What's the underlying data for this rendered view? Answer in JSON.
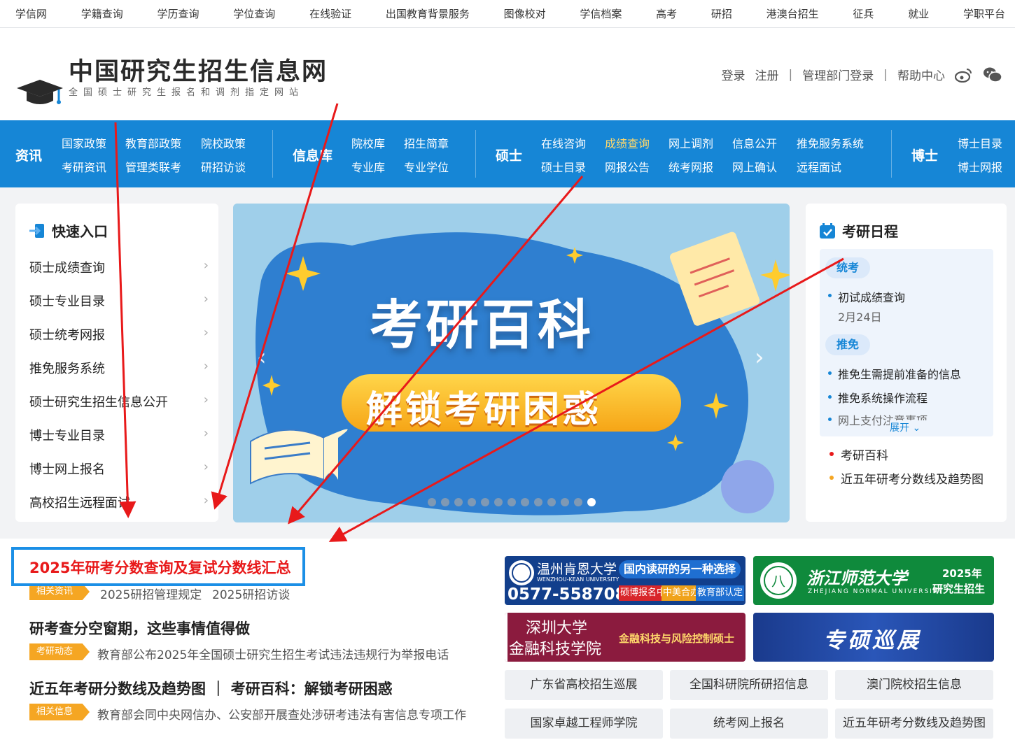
{
  "topbar": [
    "学信网",
    "学籍查询",
    "学历查询",
    "学位查询",
    "在线验证",
    "出国教育背景服务",
    "图像校对",
    "学信档案",
    "高考",
    "研招",
    "港澳台招生",
    "征兵",
    "就业",
    "学职平台"
  ],
  "header": {
    "title": "中国研究生招生信息网",
    "subtitle": "全国硕士研究生报名和调剂指定网站",
    "login": "登录",
    "register": "注册",
    "admin_login": "管理部门登录",
    "help": "帮助中心",
    "sep": "|"
  },
  "nav": {
    "zixun": {
      "head": "资讯",
      "links": [
        "国家政策",
        "教育部政策",
        "院校政策",
        "考研资讯",
        "管理类联考",
        "研招访谈"
      ]
    },
    "xinxiku": {
      "head": "信息库",
      "links": [
        "院校库",
        "招生简章",
        "专业库",
        "专业学位"
      ]
    },
    "shuoshi": {
      "head": "硕士",
      "links": [
        "在线咨询",
        "成绩查询",
        "网上调剂",
        "信息公开",
        "推免服务系统",
        "硕士目录",
        "网报公告",
        "统考网报",
        "网上确认",
        "远程面试"
      ]
    },
    "boshi": {
      "head": "博士",
      "links": [
        "博士目录",
        "博士网报"
      ]
    }
  },
  "quick": {
    "title": "快速入口",
    "items": [
      "硕士成绩查询",
      "硕士专业目录",
      "硕士统考网报",
      "推免服务系统",
      "硕士研究生招生信息公开",
      "博士专业目录",
      "博士网上报名",
      "高校招生远程面试"
    ]
  },
  "banner": {
    "title": "考研百科",
    "subtitle": "解锁考研困惑",
    "prev": "‹",
    "next": "›",
    "slide_count": 13,
    "active_slide": 13
  },
  "schedule": {
    "title": "考研日程",
    "tag1": "统考",
    "item1": "初试成绩查询",
    "item1_date": "2月24日",
    "tag2": "推免",
    "item2": "推免生需提前准备的信息",
    "item3": "推免系统操作流程",
    "item4": "网上支付注意事项",
    "expand": "展开",
    "link1": "考研百科",
    "link2": "近五年研考分数线及趋势图"
  },
  "news": {
    "headline": "2025年研考分数查询及复试分数线汇总",
    "tag1": "相关资讯",
    "sub1a": "2025研招管理规定",
    "sub1b": "2025研招访谈",
    "headline2": "研考查分空窗期，这些事情值得做",
    "tag2": "考研动态",
    "sub2": "教育部公布2025年全国硕士研究生招生考试违法违规行为举报电话",
    "headline3": "近五年考研分数线及趋势图 ｜ 考研百科：解锁考研困惑",
    "tag3": "相关信息",
    "sub3": "教育部会同中央网信办、公安部开展查处涉研考违法有害信息专项工作"
  },
  "ads": {
    "wku_name": "温州肯恩大学",
    "wku_en": "WENZHOU-KEAN UNIVERSITY",
    "wku_phone": "0577-55870888",
    "wku_slogan": "国内读研的另一种选择",
    "wku_t1": "硕博报名中",
    "wku_t2": "中美合办",
    "wku_t3": "教育部认定",
    "zjnu_name": "浙江师范大学",
    "zjnu_en": "ZHEJIANG NORMAL UNIVERSITY",
    "zjnu_year": "2025年",
    "zjnu_label": "研究生招生",
    "szu_1": "深圳大学",
    "szu_2": "金融科技学院",
    "szu_3": "金融科技与风险控制硕士",
    "tour": "专硕巡展"
  },
  "buttons": [
    "广东省高校招生巡展",
    "全国科研院所研招信息",
    "澳门院校招生信息",
    "国家卓越工程师学院",
    "统考网上报名",
    "近五年研考分数线及趋势图"
  ],
  "colors": {
    "primary": "#1686d6",
    "highlight_red": "#e8191a",
    "arrow_red": "#e8191a",
    "tag_orange": "#f5a623",
    "box_blue": "#1b8fe6"
  }
}
